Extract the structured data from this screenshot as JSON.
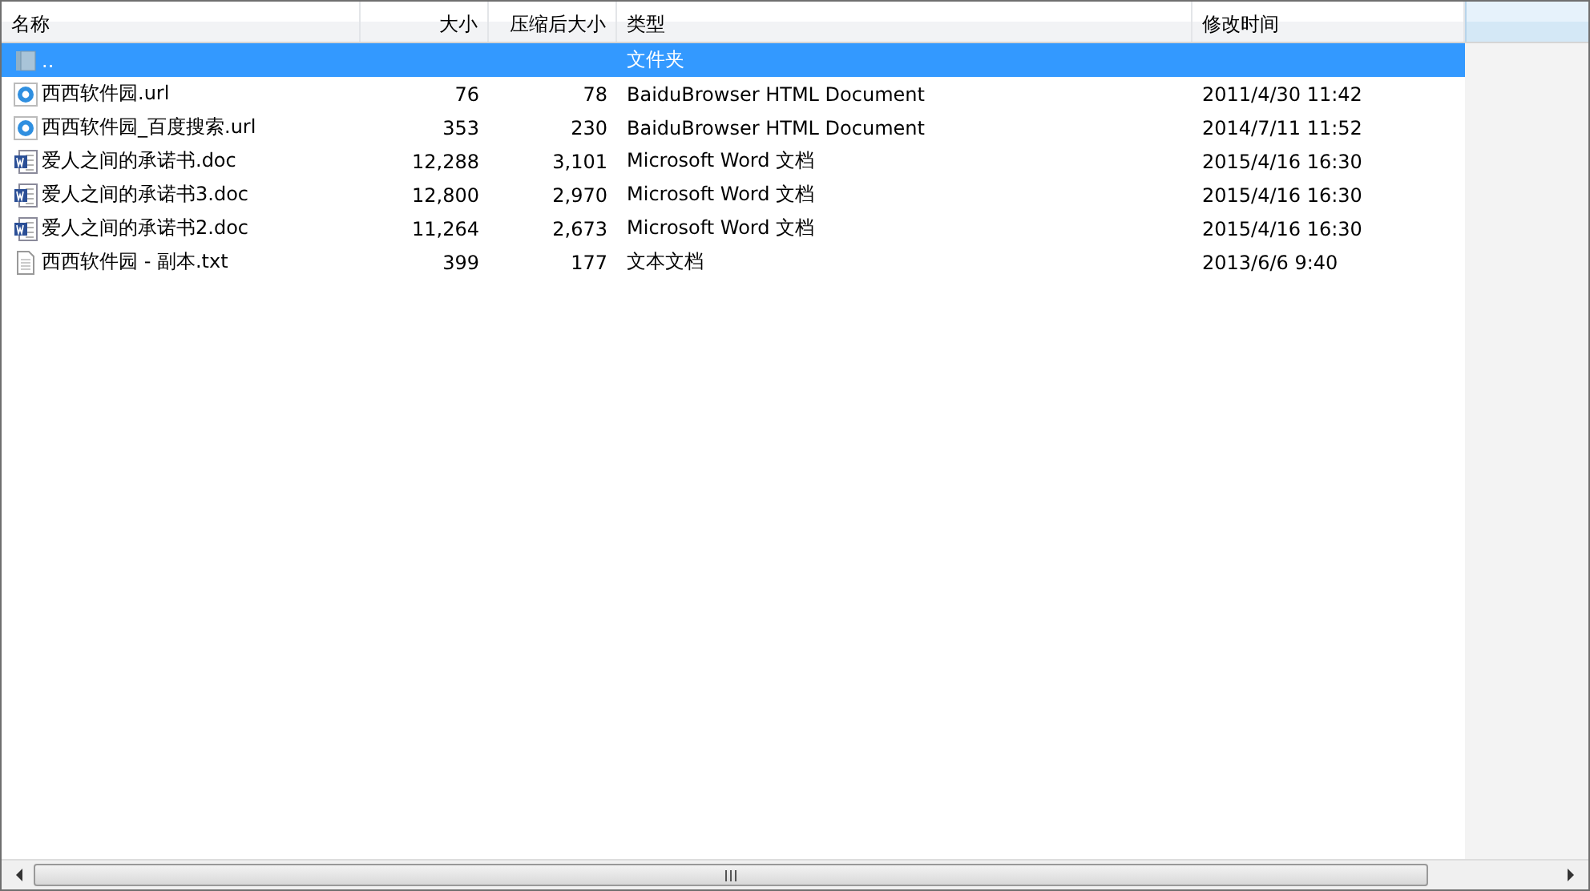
{
  "columns": [
    "名称",
    "大小",
    "压缩后大小",
    "类型",
    "修改时间"
  ],
  "rows": [
    {
      "kind": "folder",
      "name": "..",
      "size": "",
      "packed": "",
      "type": "文件夹",
      "modified": "",
      "selected": true
    },
    {
      "kind": "url",
      "name": "西西软件园.url",
      "size": "76",
      "packed": "78",
      "type": "BaiduBrowser HTML Document",
      "modified": "2011/4/30 11:42",
      "selected": false
    },
    {
      "kind": "url",
      "name": "西西软件园_百度搜索.url",
      "size": "353",
      "packed": "230",
      "type": "BaiduBrowser HTML Document",
      "modified": "2014/7/11 11:52",
      "selected": false
    },
    {
      "kind": "doc",
      "name": "爱人之间的承诺书.doc",
      "size": "12,288",
      "packed": "3,101",
      "type": "Microsoft Word 文档",
      "modified": "2015/4/16 16:30",
      "selected": false
    },
    {
      "kind": "doc",
      "name": "爱人之间的承诺书3.doc",
      "size": "12,800",
      "packed": "2,970",
      "type": "Microsoft Word 文档",
      "modified": "2015/4/16 16:30",
      "selected": false
    },
    {
      "kind": "doc",
      "name": "爱人之间的承诺书2.doc",
      "size": "11,264",
      "packed": "2,673",
      "type": "Microsoft Word 文档",
      "modified": "2015/4/16 16:30",
      "selected": false
    },
    {
      "kind": "txt",
      "name": "西西软件园 - 副本.txt",
      "size": "399",
      "packed": "177",
      "type": "文本文档",
      "modified": "2013/6/6 9:40",
      "selected": false
    }
  ]
}
